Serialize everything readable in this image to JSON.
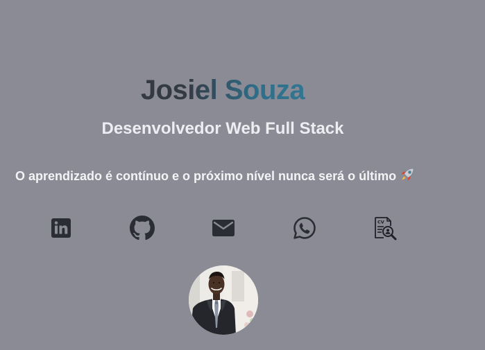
{
  "profile": {
    "name": "Josiel Souza",
    "role": "Desenvolvedor Web Full Stack",
    "motto": "O aprendizado é contínuo e o próximo nível nunca será o último"
  },
  "social_links": [
    {
      "icon": "linkedin-icon"
    },
    {
      "icon": "github-icon"
    },
    {
      "icon": "email-icon"
    },
    {
      "icon": "whatsapp-icon"
    },
    {
      "icon": "cv-search-icon"
    }
  ],
  "colors": {
    "background": "#8a8b95",
    "name_dark": "#343a44",
    "name_accent": "#3a8aa8",
    "icon": "#2b2d34",
    "text_light": "#f4f4f6"
  }
}
